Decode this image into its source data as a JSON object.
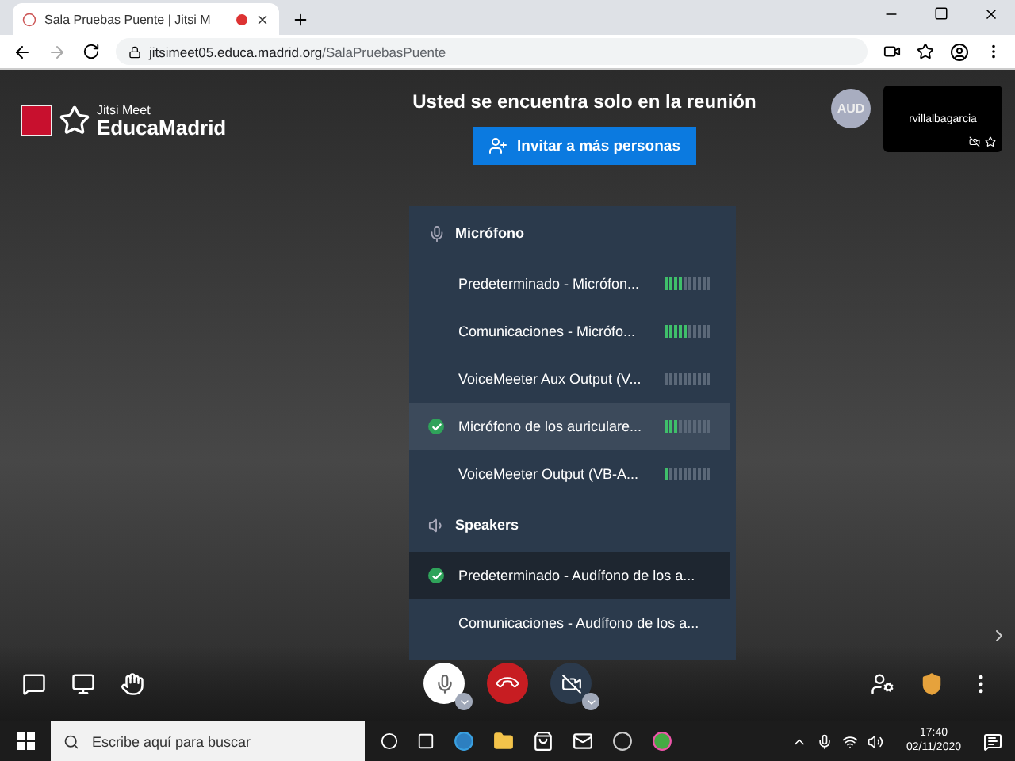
{
  "browser": {
    "tab_title": "Sala Pruebas Puente | Jitsi M",
    "url_host": "jitsimeet05.educa.madrid.org",
    "url_path": "/SalaPruebasPuente"
  },
  "header": {
    "logo_small": "Jitsi Meet",
    "logo_big": "EducaMadrid",
    "title": "Usted se encuentra solo en la reunión",
    "invite_button": "Invitar a más personas",
    "avatar": "AUD",
    "thumbnail_name": "rvillalbagarcia"
  },
  "menu": {
    "sections": [
      {
        "kind": "microphone",
        "title": "Micrófono",
        "devices": [
          {
            "name": "Predeterminado - Micrófon...",
            "selected": false,
            "hovered": false,
            "level": 0.4
          },
          {
            "name": "Comunicaciones - Micrófo...",
            "selected": false,
            "hovered": false,
            "level": 0.5
          },
          {
            "name": "VoiceMeeter Aux Output (V...",
            "selected": false,
            "hovered": false,
            "level": 0
          },
          {
            "name": "Micrófono de los auriculare...",
            "selected": true,
            "hovered": true,
            "level": 0.3
          },
          {
            "name": "VoiceMeeter Output (VB-A...",
            "selected": false,
            "hovered": false,
            "level": 0.1
          }
        ]
      },
      {
        "kind": "speakers",
        "title": "Speakers",
        "devices": [
          {
            "name": "Predeterminado - Audífono de los a...",
            "selected": true,
            "hovered": false
          },
          {
            "name": "Comunicaciones - Audífono de los a...",
            "selected": false,
            "hovered": false
          }
        ]
      }
    ]
  },
  "taskbar": {
    "search_placeholder": "Escribe aquí para buscar",
    "time": "17:40",
    "date": "02/11/2020"
  }
}
